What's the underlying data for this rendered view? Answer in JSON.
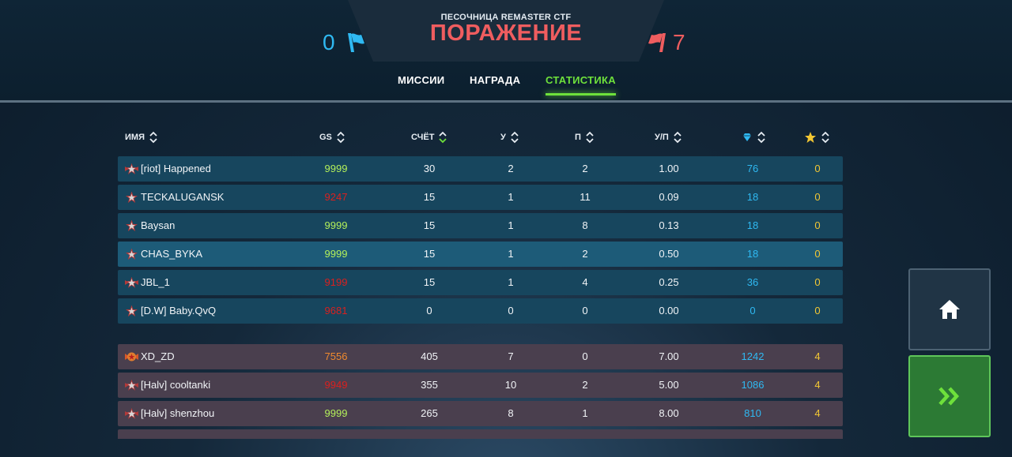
{
  "header": {
    "subtitle": "ПЕСОЧНИЦА REMASTER CTF",
    "result": "ПОРАЖЕНИЕ",
    "blue_score": "0",
    "red_score": "7"
  },
  "tabs": [
    {
      "label": "МИССИИ"
    },
    {
      "label": "НАГРАДА"
    },
    {
      "label": "СТАТИСТИКА",
      "active": true
    }
  ],
  "columns": {
    "name": "ИМЯ",
    "gs": "GS",
    "score": "СЧЁТ",
    "kills": "У",
    "deaths": "П",
    "kd": "У/П",
    "crystals_icon": "crystal-icon",
    "stars_icon": "star-icon"
  },
  "blue_team": [
    {
      "name": "[riot] Happened",
      "gs": "9999",
      "score": "30",
      "kills": "2",
      "deaths": "2",
      "kd": "1.00",
      "crystals": "76",
      "stars": "0"
    },
    {
      "name": "TECKALUGANSK",
      "gs": "9247",
      "score": "15",
      "kills": "1",
      "deaths": "11",
      "kd": "0.09",
      "crystals": "18",
      "stars": "0"
    },
    {
      "name": "Baysan",
      "gs": "9999",
      "score": "15",
      "kills": "1",
      "deaths": "8",
      "kd": "0.13",
      "crystals": "18",
      "stars": "0"
    },
    {
      "name": "CHAS_BYKA",
      "gs": "9999",
      "score": "15",
      "kills": "1",
      "deaths": "2",
      "kd": "0.50",
      "crystals": "18",
      "stars": "0"
    },
    {
      "name": "JBL_1",
      "gs": "9199",
      "score": "15",
      "kills": "1",
      "deaths": "4",
      "kd": "0.25",
      "crystals": "36",
      "stars": "0"
    },
    {
      "name": "[D.W] Baby.QvQ",
      "gs": "9681",
      "score": "0",
      "kills": "0",
      "deaths": "0",
      "kd": "0.00",
      "crystals": "0",
      "stars": "0"
    }
  ],
  "red_team": [
    {
      "name": "XD_ZD",
      "gs": "7556",
      "score": "405",
      "kills": "7",
      "deaths": "0",
      "kd": "7.00",
      "crystals": "1242",
      "stars": "4"
    },
    {
      "name": "[Halv] cooltanki",
      "gs": "9949",
      "score": "355",
      "kills": "10",
      "deaths": "2",
      "kd": "5.00",
      "crystals": "1086",
      "stars": "4"
    },
    {
      "name": "[Halv] shenzhou",
      "gs": "9999",
      "score": "265",
      "kills": "8",
      "deaths": "1",
      "kd": "8.00",
      "crystals": "810",
      "stars": "4"
    }
  ],
  "colors": {
    "blue_team": "#2fb9f2",
    "red_team": "#ef5d5f",
    "active_tab": "#6ee13b",
    "gs_max": "#b4f05a",
    "gs_low": "#d9201f",
    "gs_mid": "#f08a2e",
    "crystals": "#2fb9f2",
    "stars": "#f3c733"
  },
  "buttons": {
    "home_icon": "home-icon",
    "next_icon": "double-chevron-right-icon"
  }
}
